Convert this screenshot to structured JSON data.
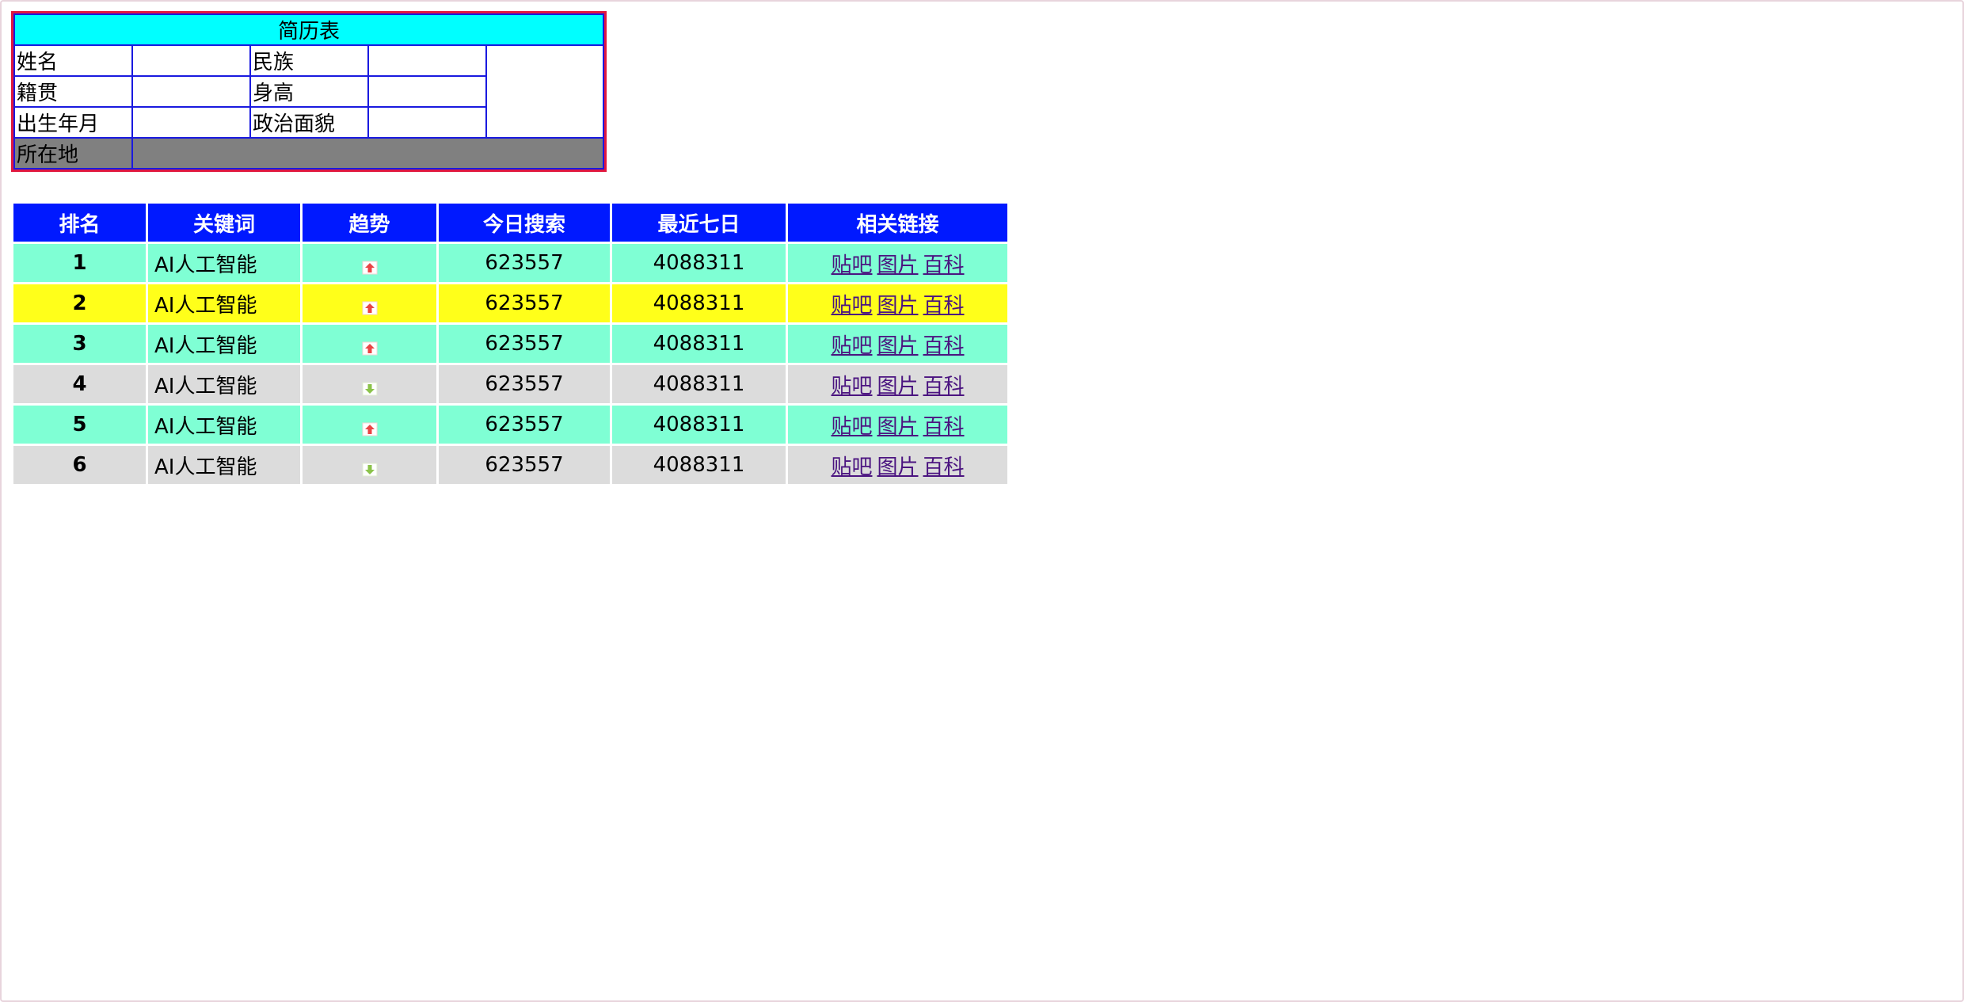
{
  "resume": {
    "title": "简历表",
    "rows": [
      {
        "label1": "姓名",
        "label2": "民族"
      },
      {
        "label1": "籍贯",
        "label2": "身高"
      },
      {
        "label1": "出生年月",
        "label2": "政治面貌"
      }
    ],
    "location_label": "所在地",
    "colors": {
      "title_bg": "#00ffff",
      "location_bg": "#808080",
      "outer_border": "#e0173f",
      "cell_border": "#1a1adf"
    }
  },
  "keywords": {
    "headers": [
      "排名",
      "关键词",
      "趋势",
      "今日搜索",
      "最近七日",
      "相关链接"
    ],
    "rows": [
      {
        "rank": "1",
        "keyword": "AI人工智能",
        "trend": "up-arrow-icon",
        "today": "623557",
        "week": "4088311",
        "bg": "#7fffd4"
      },
      {
        "rank": "2",
        "keyword": "AI人工智能",
        "trend": "up-arrow-icon",
        "today": "623557",
        "week": "4088311",
        "bg": "#ffff1a"
      },
      {
        "rank": "3",
        "keyword": "AI人工智能",
        "trend": "up-arrow-icon",
        "today": "623557",
        "week": "4088311",
        "bg": "#7fffd4"
      },
      {
        "rank": "4",
        "keyword": "AI人工智能",
        "trend": "down-arrow-icon",
        "today": "623557",
        "week": "4088311",
        "bg": "#dcdcdc"
      },
      {
        "rank": "5",
        "keyword": "AI人工智能",
        "trend": "up-arrow-icon",
        "today": "623557",
        "week": "4088311",
        "bg": "#7fffd4"
      },
      {
        "rank": "6",
        "keyword": "AI人工智能",
        "trend": "down-arrow-icon",
        "today": "623557",
        "week": "4088311",
        "bg": "#dcdcdc"
      }
    ],
    "links": [
      "贴吧",
      "图片",
      "百科"
    ],
    "colors": {
      "header_bg": "#0019ff",
      "header_text": "#ffffff",
      "link": "#4b1480",
      "up": "#e84545",
      "down": "#8bc34a"
    }
  }
}
